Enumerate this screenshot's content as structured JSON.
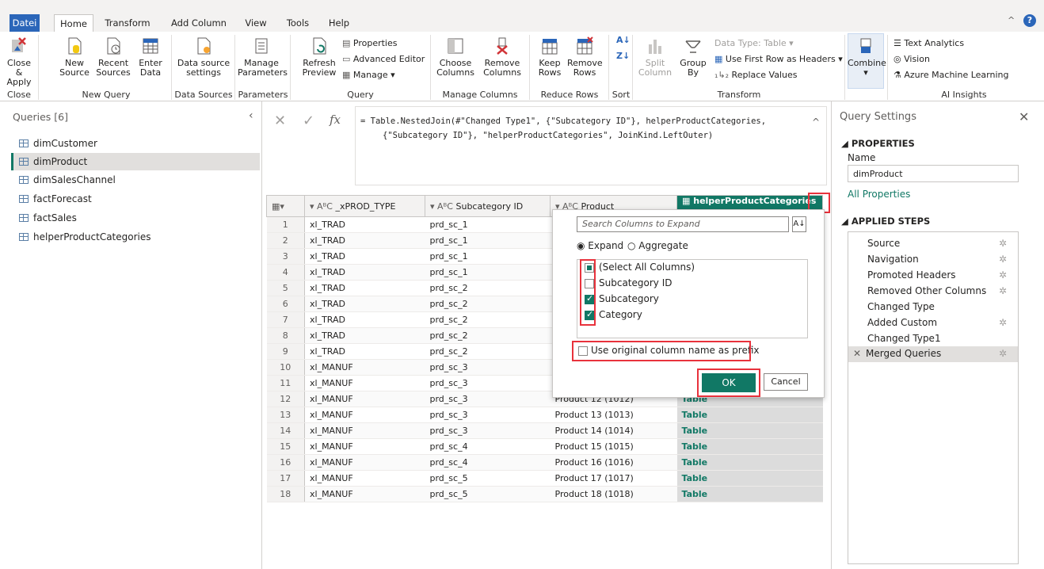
{
  "tabs": [
    "Datei",
    "Home",
    "Transform",
    "Add Column",
    "View",
    "Tools",
    "Help"
  ],
  "ribbon": {
    "close_apply": "Close & Apply",
    "new_source": "New Source",
    "recent_sources": "Recent Sources",
    "enter_data": "Enter Data",
    "data_source_settings": "Data source settings",
    "manage_parameters": "Manage Parameters",
    "refresh_preview": "Refresh Preview",
    "properties": "Properties",
    "advanced_editor": "Advanced Editor",
    "manage": "Manage",
    "choose_columns": "Choose Columns",
    "remove_columns": "Remove Columns",
    "keep_rows": "Keep Rows",
    "remove_rows": "Remove Rows",
    "split_column": "Split Column",
    "group_by": "Group By",
    "data_type": "Data Type: Table",
    "use_first_row": "Use First Row as Headers",
    "replace_values": "Replace Values",
    "combine": "Combine",
    "text_analytics": "Text Analytics",
    "vision": "Vision",
    "azure_ml": "Azure Machine Learning",
    "groups": [
      "Close",
      "New Query",
      "Data Sources",
      "Parameters",
      "Query",
      "Manage Columns",
      "Reduce Rows",
      "Sort",
      "Transform",
      "AI Insights"
    ]
  },
  "queries": {
    "header": "Queries [6]",
    "items": [
      "dimCustomer",
      "dimProduct",
      "dimSalesChannel",
      "factForecast",
      "factSales",
      "helperProductCategories"
    ],
    "selected": "dimProduct"
  },
  "formula": {
    "fx": "fx",
    "line1": "= Table.NestedJoin(#\"Changed Type1\", {\"Subcategory ID\"}, helperProductCategories,",
    "line2": "{\"Subcategory ID\"}, \"helperProductCategories\", JoinKind.LeftOuter)"
  },
  "grid": {
    "columns": [
      "_xPROD_TYPE",
      "Subcategory ID",
      "Product",
      "helperProductCategories"
    ],
    "rows": [
      [
        "1",
        "xl_TRAD",
        "prd_sc_1",
        "",
        ""
      ],
      [
        "2",
        "xl_TRAD",
        "prd_sc_1",
        "",
        ""
      ],
      [
        "3",
        "xl_TRAD",
        "prd_sc_1",
        "",
        ""
      ],
      [
        "4",
        "xl_TRAD",
        "prd_sc_1",
        "",
        ""
      ],
      [
        "5",
        "xl_TRAD",
        "prd_sc_2",
        "",
        ""
      ],
      [
        "6",
        "xl_TRAD",
        "prd_sc_2",
        "",
        ""
      ],
      [
        "7",
        "xl_TRAD",
        "prd_sc_2",
        "",
        ""
      ],
      [
        "8",
        "xl_TRAD",
        "prd_sc_2",
        "",
        ""
      ],
      [
        "9",
        "xl_TRAD",
        "prd_sc_2",
        "",
        ""
      ],
      [
        "10",
        "xl_MANUF",
        "prd_sc_3",
        "",
        ""
      ],
      [
        "11",
        "xl_MANUF",
        "prd_sc_3",
        "",
        ""
      ],
      [
        "12",
        "xl_MANUF",
        "prd_sc_3",
        "Product 12 (1012)",
        "Table"
      ],
      [
        "13",
        "xl_MANUF",
        "prd_sc_3",
        "Product 13 (1013)",
        "Table"
      ],
      [
        "14",
        "xl_MANUF",
        "prd_sc_3",
        "Product 14 (1014)",
        "Table"
      ],
      [
        "15",
        "xl_MANUF",
        "prd_sc_4",
        "Product 15 (1015)",
        "Table"
      ],
      [
        "16",
        "xl_MANUF",
        "prd_sc_4",
        "Product 16 (1016)",
        "Table"
      ],
      [
        "17",
        "xl_MANUF",
        "prd_sc_5",
        "Product 17 (1017)",
        "Table"
      ],
      [
        "18",
        "xl_MANUF",
        "prd_sc_5",
        "Product 18 (1018)",
        "Table"
      ]
    ]
  },
  "popup": {
    "search_placeholder": "Search Columns to Expand",
    "expand": "Expand",
    "aggregate": "Aggregate",
    "options": [
      {
        "label": "(Select All Columns)",
        "state": "partial"
      },
      {
        "label": "Subcategory ID",
        "state": "off"
      },
      {
        "label": "Subcategory",
        "state": "on"
      },
      {
        "label": "Category",
        "state": "on"
      }
    ],
    "prefix_label": "Use original column name as prefix",
    "ok": "OK",
    "cancel": "Cancel"
  },
  "settings": {
    "title": "Query Settings",
    "properties": "PROPERTIES",
    "name_label": "Name",
    "name_value": "dimProduct",
    "all_properties": "All Properties",
    "applied_steps": "APPLIED STEPS",
    "steps": [
      {
        "label": "Source",
        "gear": true
      },
      {
        "label": "Navigation",
        "gear": true
      },
      {
        "label": "Promoted Headers",
        "gear": true
      },
      {
        "label": "Removed Other Columns",
        "gear": true
      },
      {
        "label": "Changed Type",
        "gear": false
      },
      {
        "label": "Added Custom",
        "gear": true
      },
      {
        "label": "Changed Type1",
        "gear": false
      },
      {
        "label": "Merged Queries",
        "gear": true
      }
    ]
  },
  "colors": {
    "accent": "#117865",
    "file_tab": "#2b66b9",
    "highlight": "#e8323c"
  }
}
